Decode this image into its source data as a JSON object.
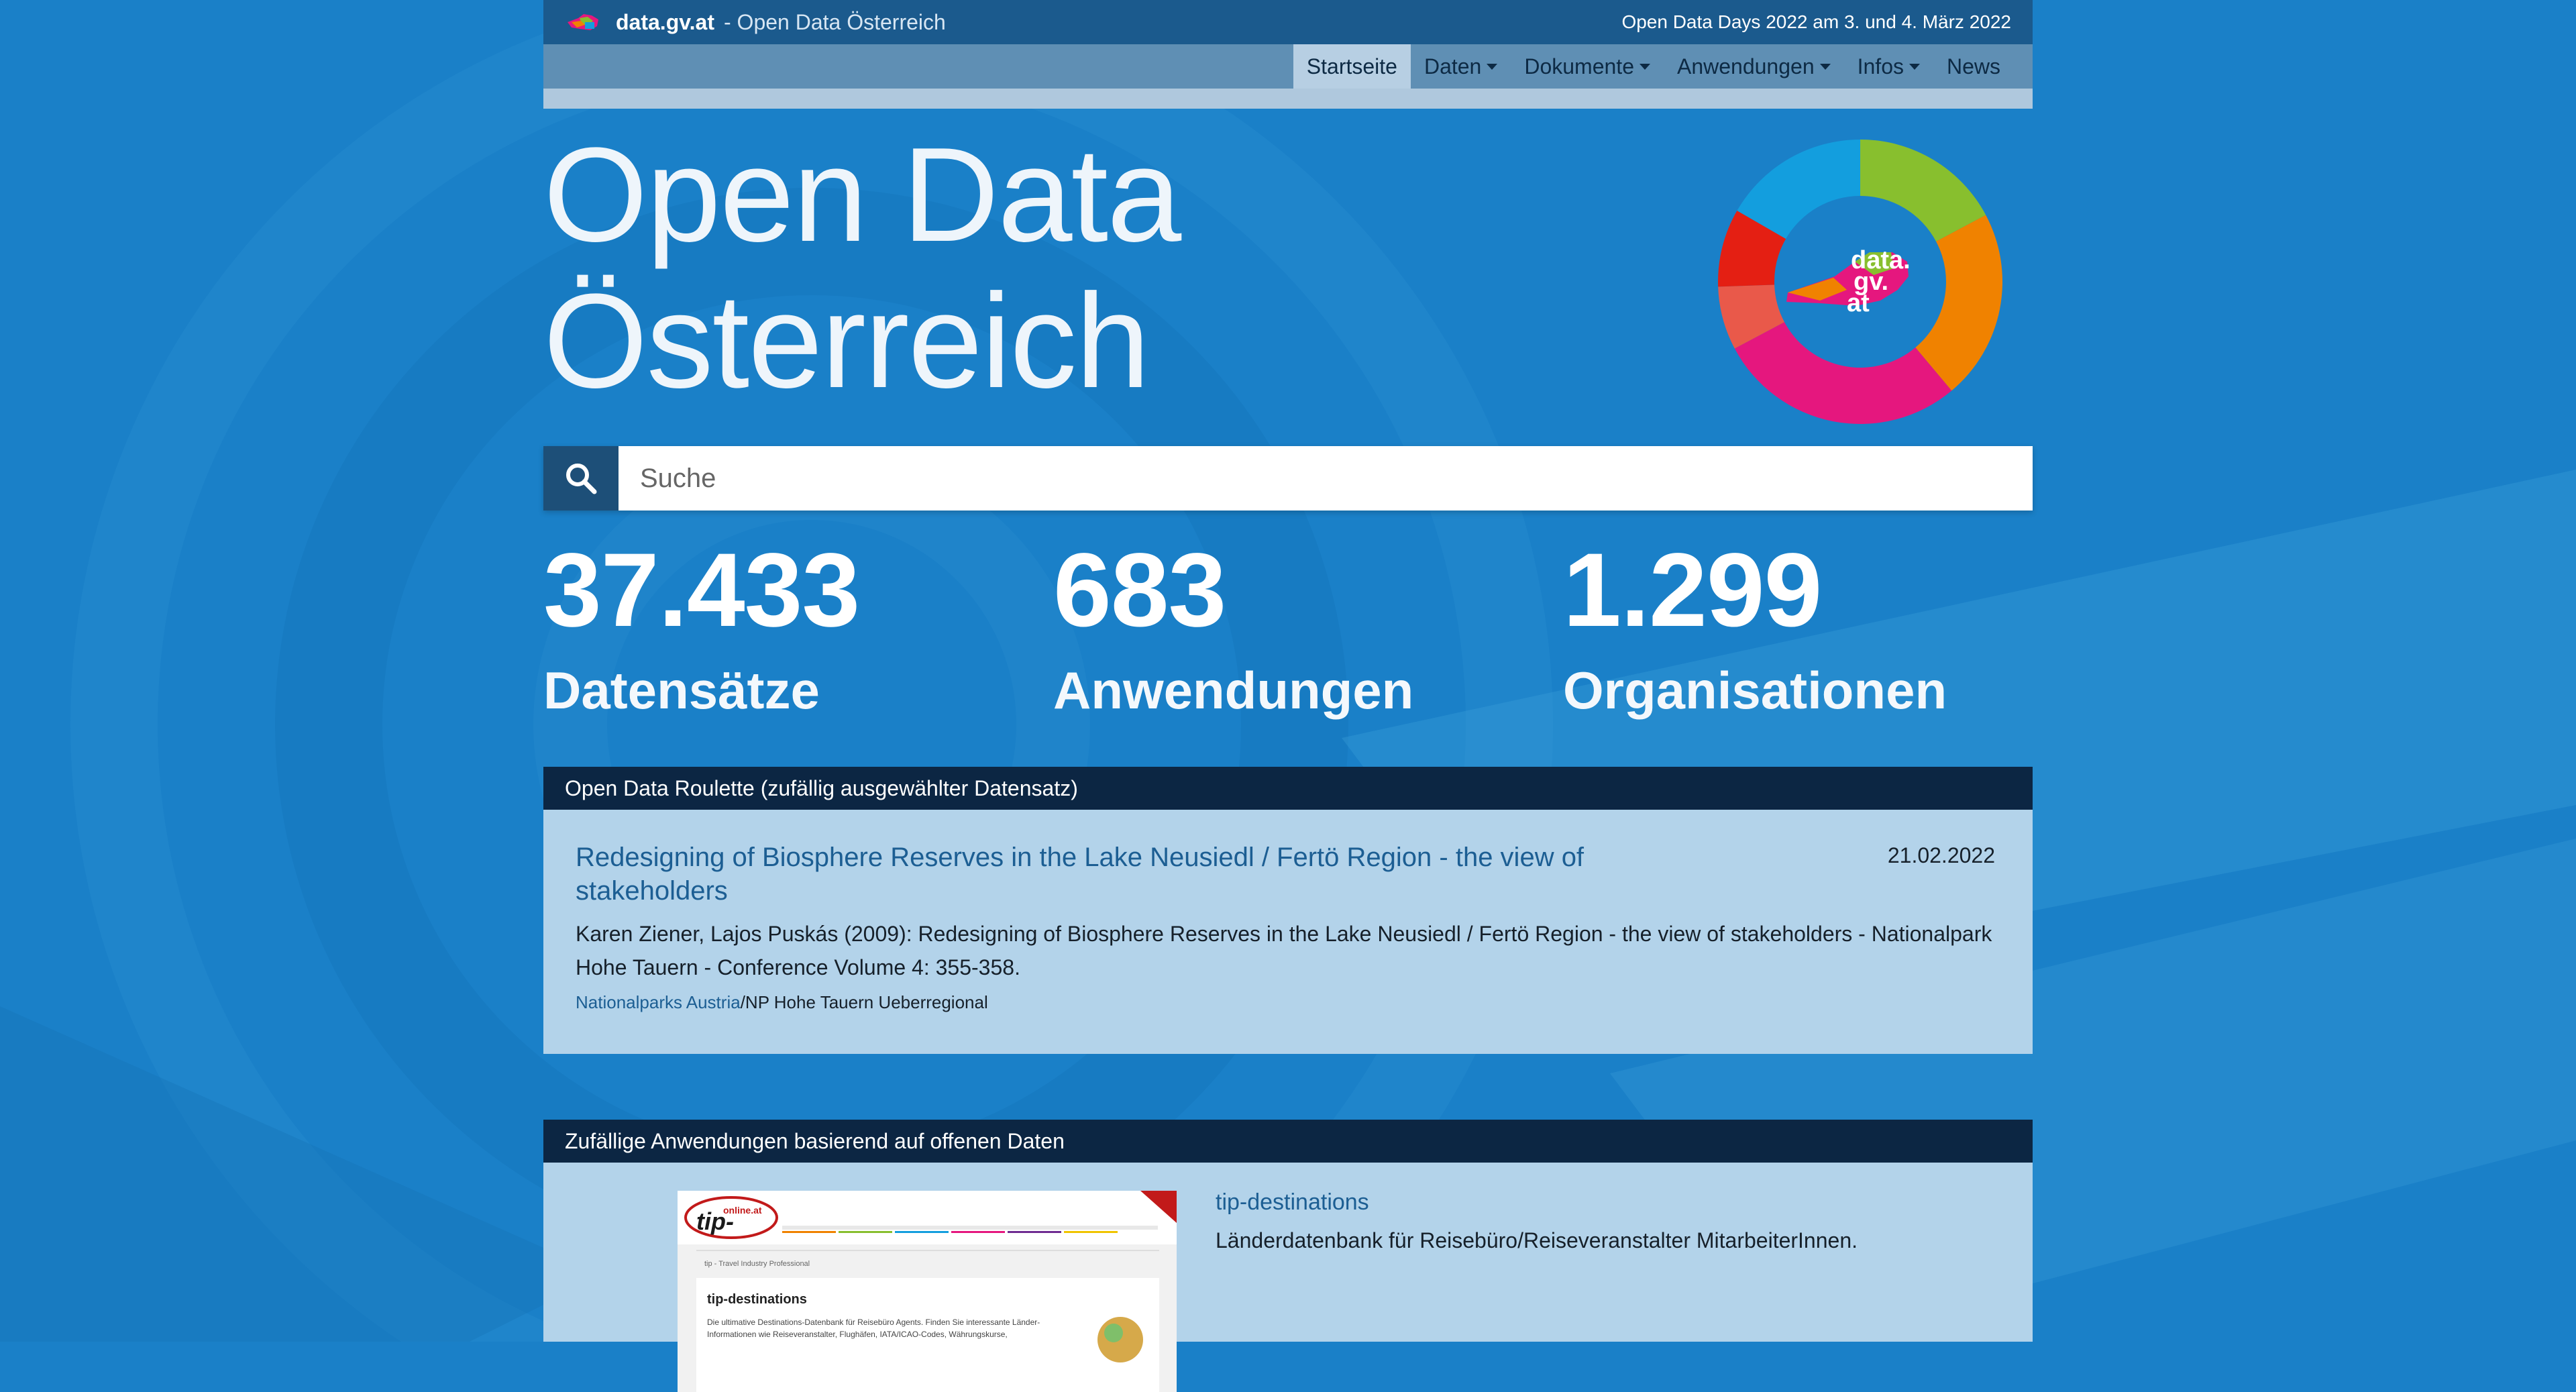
{
  "header": {
    "brand": "data.gv.at",
    "subtitle": "- Open Data Österreich",
    "announcement": "Open Data Days 2022 am 3. und 4. März 2022"
  },
  "nav": {
    "items": [
      {
        "label": "Startseite",
        "active": true,
        "dropdown": false
      },
      {
        "label": "Daten",
        "active": false,
        "dropdown": true
      },
      {
        "label": "Dokumente",
        "active": false,
        "dropdown": true
      },
      {
        "label": "Anwendungen",
        "active": false,
        "dropdown": true
      },
      {
        "label": "Infos",
        "active": false,
        "dropdown": true
      },
      {
        "label": "News",
        "active": false,
        "dropdown": false
      }
    ]
  },
  "hero": {
    "title_line1": "Open Data",
    "title_line2": "Österreich",
    "logo_text": [
      "data.",
      "gv.",
      "at"
    ]
  },
  "search": {
    "placeholder": "Suche",
    "value": ""
  },
  "stats": [
    {
      "number": "37.433",
      "label": "Datensätze"
    },
    {
      "number": "683",
      "label": "Anwendungen"
    },
    {
      "number": "1.299",
      "label": "Organisationen"
    }
  ],
  "roulette": {
    "heading": "Open Data Roulette (zufällig ausgewählter Datensatz)",
    "title_line1": "Redesigning of Biosphere Reserves in the Lake Neusiedl / Fertö Region - the view of",
    "title_line2": "stakeholders",
    "date": "21.02.2022",
    "desc_line1": "Karen Ziener, Lajos Puskás (2009): Redesigning of Biosphere Reserves in the Lake Neusiedl / Fertö Region - the view of stakeholders - Nationalpark",
    "desc_line2": "Hohe Tauern - Conference Volume 4: 355-358.",
    "org_link": "Nationalparks Austria",
    "org_rest": "/NP Hohe Tauern Ueberregional"
  },
  "apps": {
    "heading": "Zufällige Anwendungen basierend auf offenen Daten",
    "app_title": "tip-destinations",
    "app_desc": "Länderdatenbank für Reisebüro/Reiseveranstalter MitarbeiterInnen.",
    "thumb": {
      "logo_top": "online.at",
      "logo_main": "tip-",
      "page_heading": "tip-destinations",
      "breadcrumb": "tip - Travel Industry Professional",
      "body_line1": "Die ultimative Destinations-Datenbank für Reisebüro Agents. Finden Sie interessante Länder-",
      "body_line2": "Informationen wie Reiseveranstalter, Flughäfen, IATA/ICAO-Codes, Währungskurse,"
    }
  },
  "colors": {
    "background": "#1a80c8",
    "topbar": "#1b5a8d",
    "navbar": "#5f8fb4",
    "panel_head": "#0c2643",
    "panel_body": "#b3d3ea",
    "link": "#1c5e93",
    "donut": [
      "#88bf2e",
      "#f08200",
      "#e5177e",
      "#e9594a",
      "#e41f13",
      "#139ede"
    ]
  },
  "icons": {
    "search": "search-icon",
    "logo": "data-gv-at-logo"
  }
}
